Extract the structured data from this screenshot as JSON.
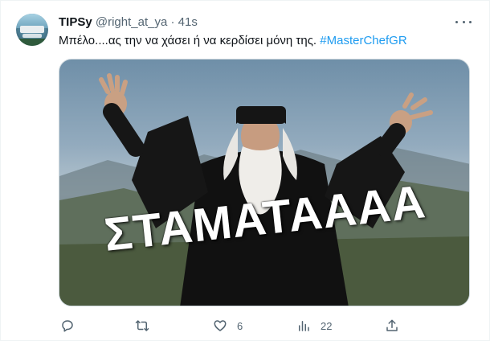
{
  "tweet": {
    "display_name": "TIPSy",
    "handle": "@right_at_ya",
    "separator": "·",
    "time": "41s",
    "text": "Μπέλο....ας την να χάσει ή να κερδίσει μόνη της. ",
    "hashtag": "#MasterChefGR",
    "media": {
      "caption": "ΣΤΑΜΑΤΑΑΑΑ"
    },
    "actions": {
      "reply_count": "",
      "retweet_count": "",
      "like_count": "6",
      "views_count": "22",
      "share_count": ""
    }
  },
  "colors": {
    "accent": "#1d9bf0",
    "secondary_text": "#536471",
    "primary_text": "#0f1419"
  },
  "icons": [
    "avatar",
    "more-icon",
    "reply-icon",
    "retweet-icon",
    "like-icon",
    "views-icon",
    "share-icon"
  ]
}
